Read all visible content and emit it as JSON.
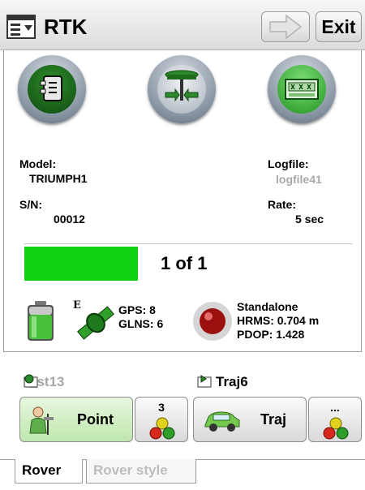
{
  "titlebar": {
    "title": "RTK",
    "exit_label": "Exit",
    "menu_icon": "menu-icon",
    "forward_icon": "arrow-right-icon"
  },
  "receiver": {
    "model_label": "Model:",
    "model_value": "TRIUMPH1",
    "sn_label": "S/N:",
    "sn_value": "00012",
    "logfile_label": "Logfile:",
    "logfile_value": "logfile41",
    "rate_label": "Rate:",
    "rate_value": "5 sec"
  },
  "progress": {
    "text": "1 of 1",
    "fraction": 1.0,
    "color": "#12d012"
  },
  "status": {
    "gps": "GPS: 8",
    "glns": "GLNS: 6",
    "e_marker": "E",
    "solution": "Standalone",
    "hrms": "HRMS: 0.704 m",
    "pdop": "PDOP: 1.428"
  },
  "collection": {
    "point_name": "_st13",
    "traj_name": "Traj6",
    "point_button": "Point",
    "point_count": "3",
    "traj_button": "Traj",
    "more_label": "..."
  },
  "tabs": [
    {
      "label": "Rover"
    },
    {
      "label": "Rover style"
    }
  ]
}
